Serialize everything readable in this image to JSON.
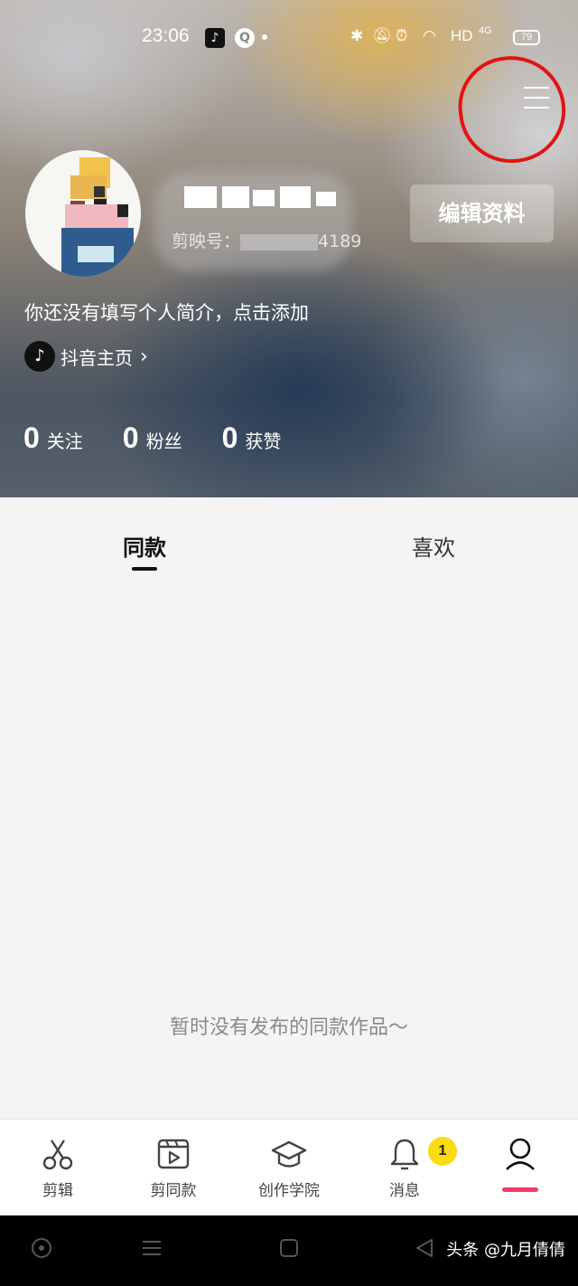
{
  "status_bar": {
    "time": "23:06",
    "hd_label": "HD",
    "signal_label": "4G",
    "battery": "79"
  },
  "profile": {
    "jianying_id_label": "剪映号：",
    "jianying_id_suffix": "4189",
    "edit_button": "编辑资料",
    "bio": "你还没有填写个人简介，点击添加",
    "douyin_link": "抖音主页",
    "stats": [
      {
        "count": "0",
        "label": "关注"
      },
      {
        "count": "0",
        "label": "粉丝"
      },
      {
        "count": "0",
        "label": "获赞"
      }
    ]
  },
  "tabs": [
    {
      "label": "同款",
      "active": true
    },
    {
      "label": "喜欢",
      "active": false
    }
  ],
  "empty_message": "暂时没有发布的同款作品～",
  "bottom_nav": [
    {
      "label": "剪辑",
      "icon": "scissors-icon"
    },
    {
      "label": "剪同款",
      "icon": "video-template-icon"
    },
    {
      "label": "创作学院",
      "icon": "graduation-cap-icon"
    },
    {
      "label": "消息",
      "icon": "bell-icon",
      "badge": "1"
    },
    {
      "label": "",
      "icon": "user-icon",
      "active": true
    }
  ],
  "watermark": "头条 @九月倩倩",
  "colors": {
    "accent_pink": "#f53c64",
    "badge_yellow": "#fadb14",
    "annotation_red": "#e01414"
  }
}
